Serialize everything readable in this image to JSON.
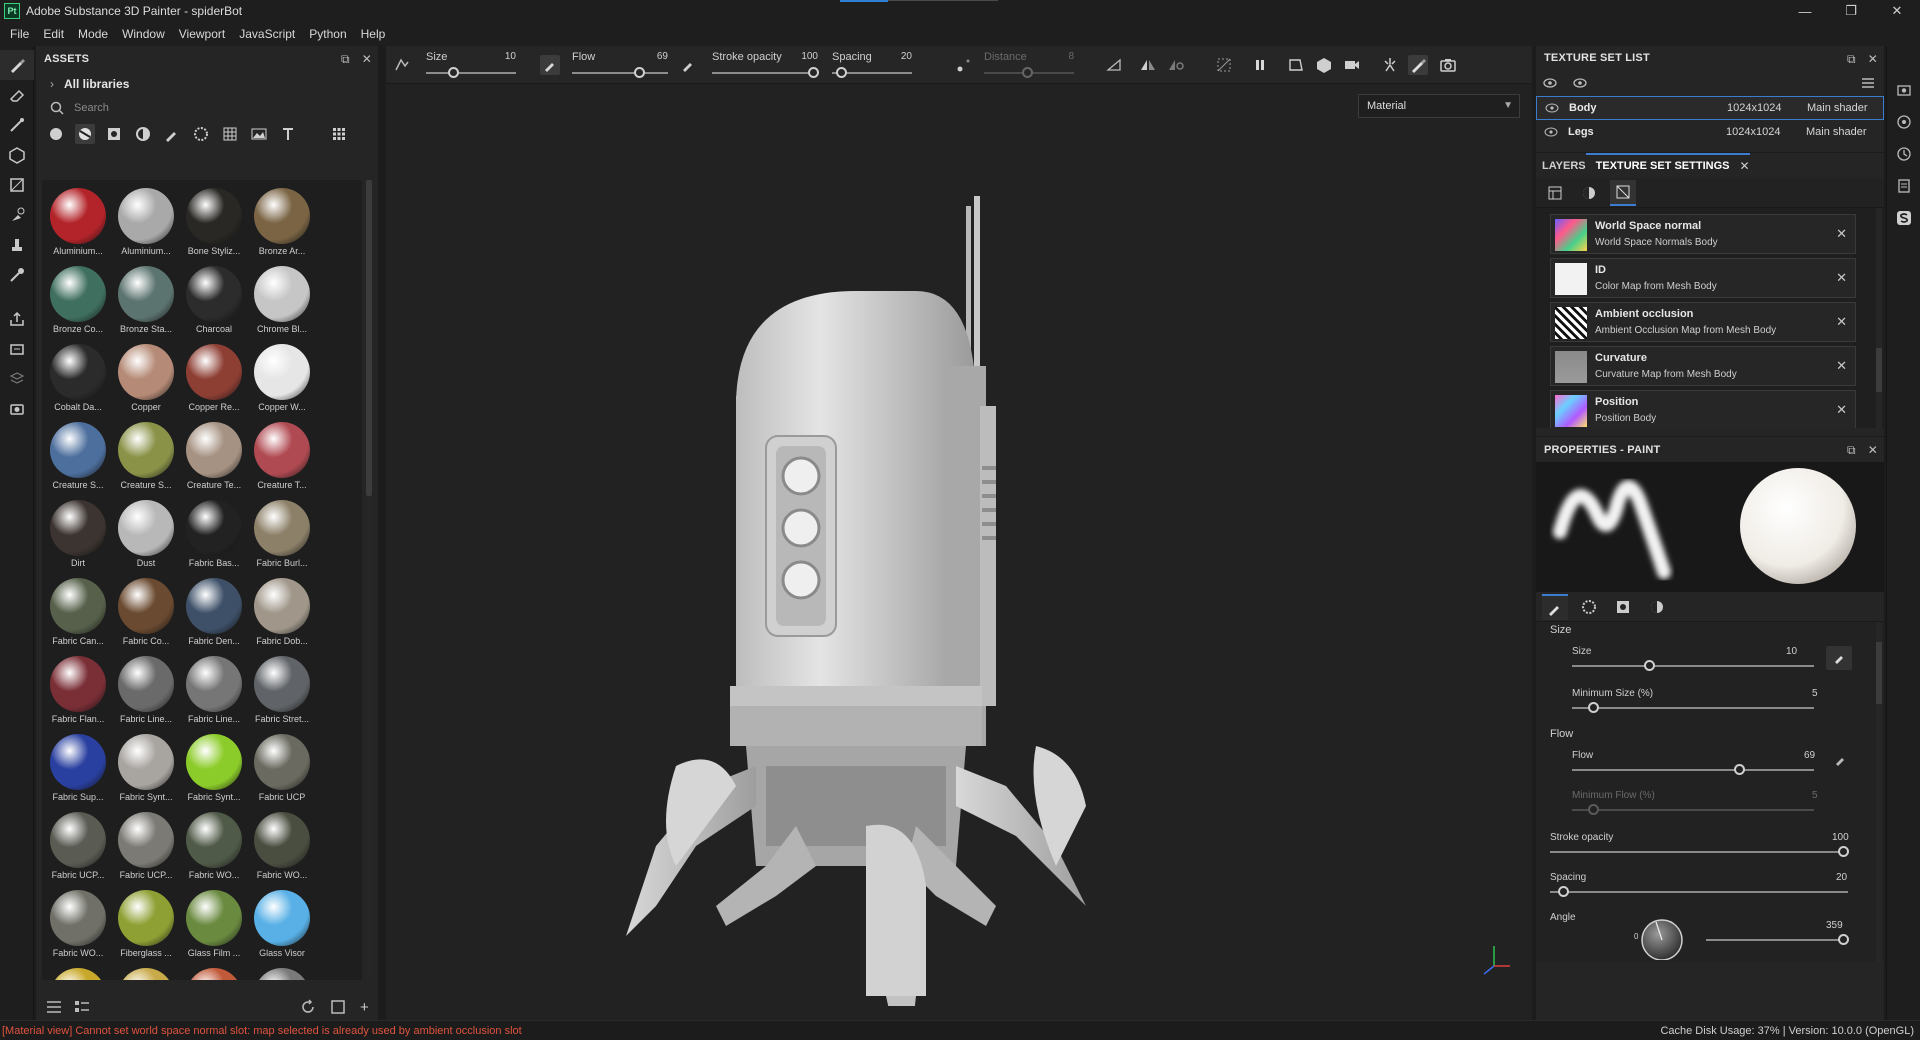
{
  "window": {
    "app_badge": "Pt",
    "title": "Adobe Substance 3D Painter - spiderBot",
    "controls": [
      "—",
      "❐",
      "✕"
    ]
  },
  "menu": [
    "File",
    "Edit",
    "Mode",
    "Window",
    "Viewport",
    "JavaScript",
    "Python",
    "Help"
  ],
  "assets": {
    "title": "ASSETS",
    "library": "All libraries",
    "search_placeholder": "Search",
    "materials": [
      {
        "label": "Aluminium...",
        "color": "#b3242a"
      },
      {
        "label": "Aluminium...",
        "color": "#a9a9a9"
      },
      {
        "label": "Bone Styliz...",
        "color": "#2a2824"
      },
      {
        "label": "Bronze Ar...",
        "color": "#7a6444"
      },
      {
        "label": "Bronze Co...",
        "color": "#3f6f5e"
      },
      {
        "label": "Bronze Sta...",
        "color": "#5c7470"
      },
      {
        "label": "Charcoal",
        "color": "#2c2c2c"
      },
      {
        "label": "Chrome Bl...",
        "color": "#c6c6c6"
      },
      {
        "label": "Cobalt Da...",
        "color": "#2b2b2b"
      },
      {
        "label": "Copper",
        "color": "#b58a76"
      },
      {
        "label": "Copper Re...",
        "color": "#8e3f34"
      },
      {
        "label": "Copper W...",
        "color": "#e6e6e6"
      },
      {
        "label": "Creature S...",
        "color": "#4d6f9e"
      },
      {
        "label": "Creature S...",
        "color": "#8a9248"
      },
      {
        "label": "Creature Te...",
        "color": "#a69282"
      },
      {
        "label": "Creature T...",
        "color": "#b04a52"
      },
      {
        "label": "Dirt",
        "color": "#3c3430"
      },
      {
        "label": "Dust",
        "color": "#b8b8b8"
      },
      {
        "label": "Fabric Bas...",
        "color": "#222222"
      },
      {
        "label": "Fabric Burl...",
        "color": "#8c8068"
      },
      {
        "label": "Fabric Can...",
        "color": "#56604a"
      },
      {
        "label": "Fabric Co...",
        "color": "#6a4a30"
      },
      {
        "label": "Fabric Den...",
        "color": "#3e5068"
      },
      {
        "label": "Fabric Dob...",
        "color": "#a0978a"
      },
      {
        "label": "Fabric Flan...",
        "color": "#7a2e36"
      },
      {
        "label": "Fabric Line...",
        "color": "#6a6a6a"
      },
      {
        "label": "Fabric Line...",
        "color": "#767676"
      },
      {
        "label": "Fabric Stret...",
        "color": "#606468"
      },
      {
        "label": "Fabric Sup...",
        "color": "#2a40a0"
      },
      {
        "label": "Fabric Synt...",
        "color": "#a8a4a0"
      },
      {
        "label": "Fabric Synt...",
        "color": "#8ccc2a"
      },
      {
        "label": "Fabric UCP",
        "color": "#6a6a60"
      },
      {
        "label": "Fabric UCP...",
        "color": "#5a5c54"
      },
      {
        "label": "Fabric UCP...",
        "color": "#7c7a74"
      },
      {
        "label": "Fabric WO...",
        "color": "#505a48"
      },
      {
        "label": "Fabric WO...",
        "color": "#4a4e40"
      },
      {
        "label": "Fabric WO...",
        "color": "#707068"
      },
      {
        "label": "Fiberglass ...",
        "color": "#8ea034"
      },
      {
        "label": "Glass Film ...",
        "color": "#6a8a40"
      },
      {
        "label": "Glass Visor",
        "color": "#58b0e6"
      },
      {
        "label": "",
        "color": "#c8a82a"
      },
      {
        "label": "",
        "color": "#c8aa4a"
      },
      {
        "label": "",
        "color": "#c05a3a"
      },
      {
        "label": "",
        "color": "#7a7a7a"
      }
    ]
  },
  "toolbar": {
    "size_label": "Size",
    "size_value": "10",
    "flow_label": "Flow",
    "flow_value": "69",
    "stroke_label": "Stroke opacity",
    "stroke_value": "100",
    "spacing_label": "Spacing",
    "spacing_value": "20",
    "distance_label": "Distance",
    "distance_value": "8"
  },
  "viewport": {
    "display_mode": "Material"
  },
  "texture_set_list": {
    "title": "TEXTURE SET LIST",
    "rows": [
      {
        "name": "Body",
        "res": "1024x1024",
        "shader": "Main shader"
      },
      {
        "name": "Legs",
        "res": "1024x1024",
        "shader": "Main shader"
      }
    ]
  },
  "tabs": {
    "layers": "LAYERS",
    "tss": "TEXTURE SET SETTINGS"
  },
  "maps": [
    {
      "title": "World Space normal",
      "sub": "World Space Normals Body"
    },
    {
      "title": "ID",
      "sub": "Color Map from Mesh Body"
    },
    {
      "title": "Ambient occlusion",
      "sub": "Ambient Occlusion Map from Mesh Body"
    },
    {
      "title": "Curvature",
      "sub": "Curvature Map from Mesh Body"
    },
    {
      "title": "Position",
      "sub": "Position Body"
    }
  ],
  "properties": {
    "title": "PROPERTIES - PAINT",
    "section_size": "Size",
    "size_label": "Size",
    "size_value": "10",
    "minsize_label": "Minimum Size (%)",
    "minsize_value": "5",
    "section_flow": "Flow",
    "flow_label": "Flow",
    "flow_value": "69",
    "minflow_label": "Minimum Flow (%)",
    "minflow_value": "5",
    "stroke_label": "Stroke opacity",
    "stroke_value": "100",
    "spacing_label": "Spacing",
    "spacing_value": "20",
    "angle_label": "Angle",
    "angle_value": "359",
    "angle_zero": "0"
  },
  "status": {
    "error": "[Material view] Cannot set world space normal slot: map selected is already used by ambient occlusion slot",
    "info": "Cache Disk Usage:   37%  |  Version: 10.0.0 (OpenGL)"
  },
  "colors": {
    "accent": "#3b7bd0",
    "error": "#e0533d",
    "robot": "#cfcfcf"
  }
}
